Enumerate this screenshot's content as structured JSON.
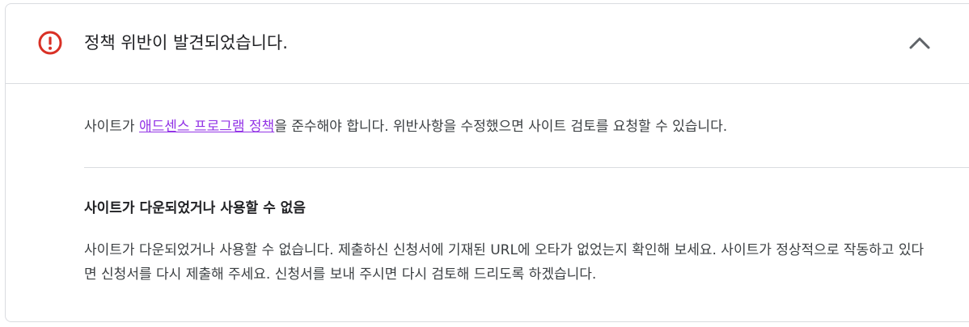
{
  "header": {
    "title": "정책 위반이 발견되었습니다.",
    "icon": "error-circle-icon",
    "toggle_icon": "chevron-up-icon",
    "accent_color": "#d93025"
  },
  "intro": {
    "before_link": "사이트가 ",
    "link_text": "애드센스 프로그램 정책",
    "after_link": "을 준수해야 합니다. 위반사항을 수정했으면 사이트 검토를 요청할 수 있습니다.",
    "link_color": "#9334e6"
  },
  "section": {
    "title": "사이트가 다운되었거나 사용할 수 없음",
    "body": "사이트가 다운되었거나 사용할 수 없습니다. 제출하신 신청서에 기재된 URL에 오타가 없었는지 확인해 보세요. 사이트가 정상적으로 작동하고 있다면 신청서를 다시 제출해 주세요. 신청서를 보내 주시면 다시 검토해 드리도록 하겠습니다."
  }
}
